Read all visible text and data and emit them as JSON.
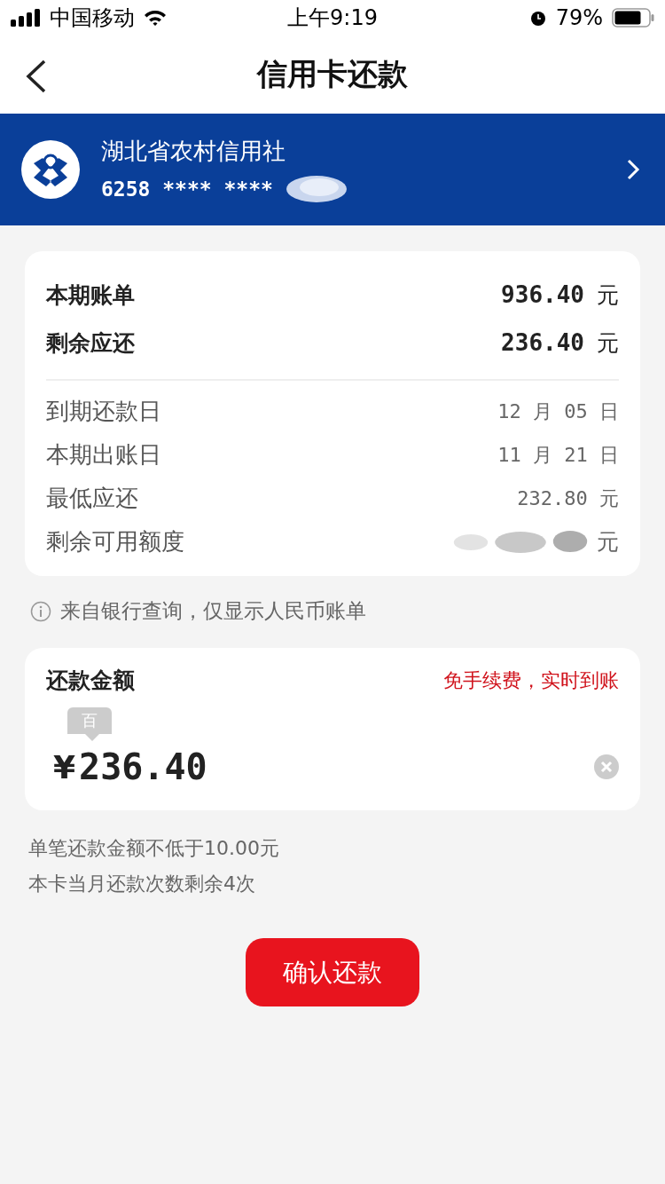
{
  "status_bar": {
    "carrier": "中国移动",
    "time": "上午9:19",
    "battery": "79%"
  },
  "nav": {
    "title": "信用卡还款"
  },
  "card": {
    "bank": "湖北省农村信用社",
    "number": "6258 **** ****",
    "number_redacted": true
  },
  "summary": {
    "main_rows": [
      {
        "label": "本期账单",
        "value": "936.40",
        "unit": "元"
      },
      {
        "label": "剩余应还",
        "value": "236.40",
        "unit": "元"
      }
    ],
    "detail_rows": [
      {
        "label": "到期还款日",
        "value": "12 月 05 日",
        "kind": "text"
      },
      {
        "label": "本期出账日",
        "value": "11 月 21 日",
        "kind": "text"
      },
      {
        "label": "最低应还",
        "value": "232.80 元",
        "kind": "text"
      },
      {
        "label": "剩余可用额度",
        "value": "元",
        "kind": "redacted"
      }
    ]
  },
  "info_note": "来自银行查询，仅显示人民币账单",
  "payment": {
    "label": "还款金额",
    "promo": "免手续费，实时到账",
    "digit_hint": "百",
    "currency": "¥",
    "value": "236.40"
  },
  "notes": [
    "单笔还款金额不低于10.00元",
    "本卡当月还款次数剩余4次"
  ],
  "confirm_button": "确认还款"
}
